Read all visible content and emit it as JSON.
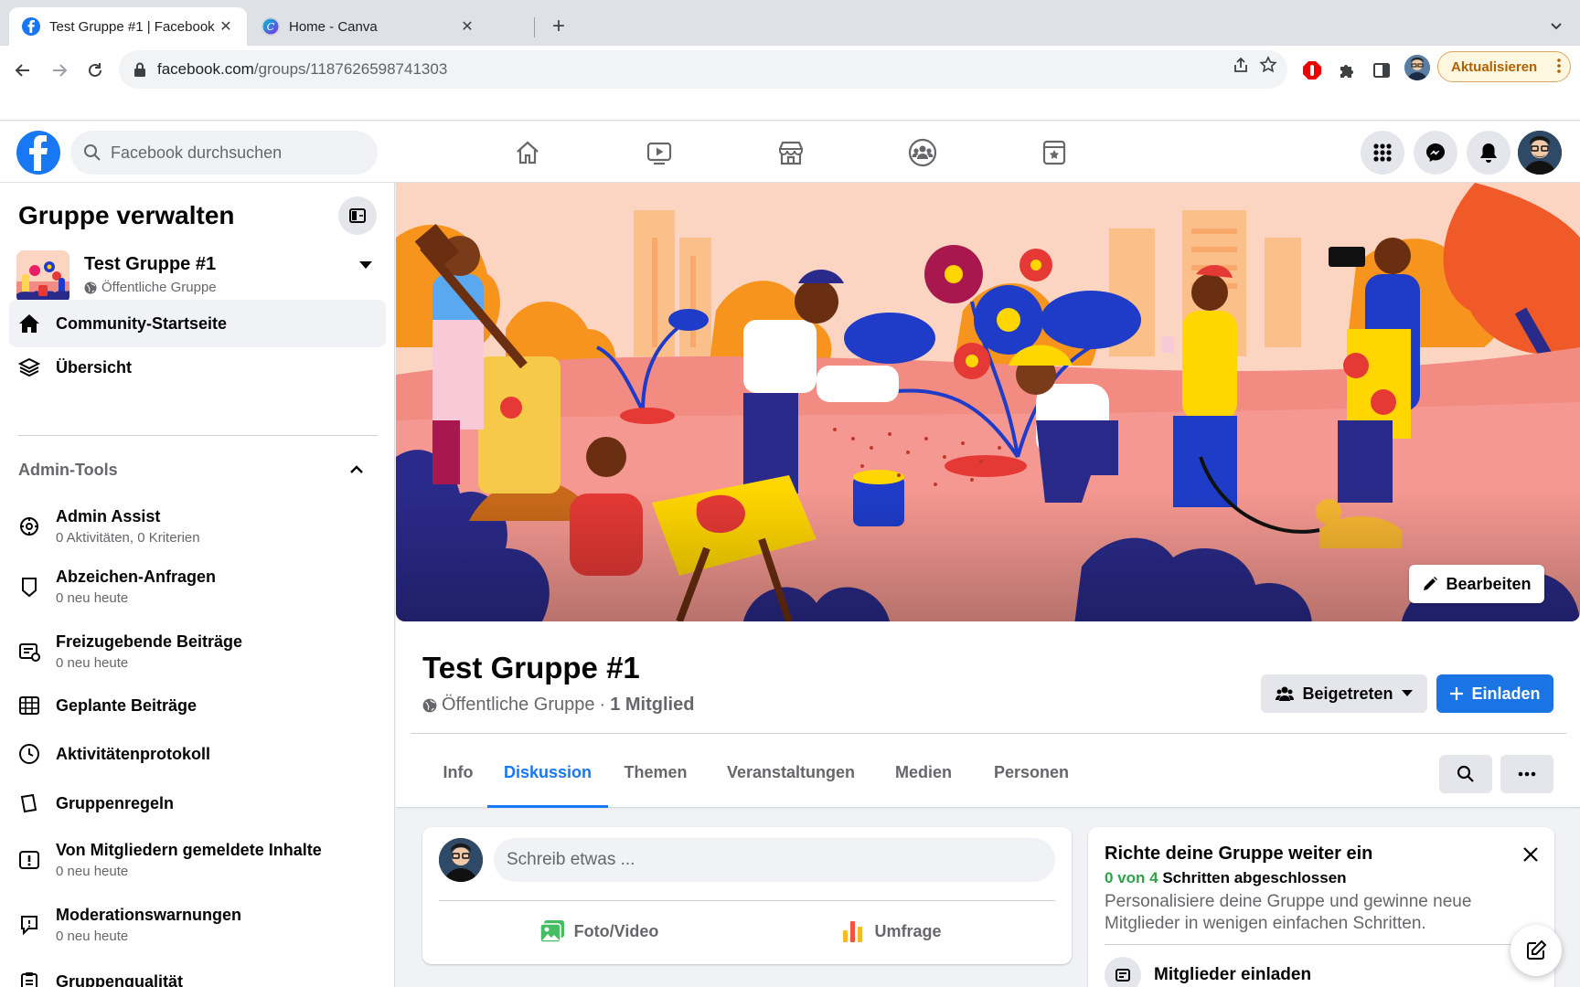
{
  "browser": {
    "tabs": [
      {
        "title": "Test Gruppe #1 | Facebook",
        "active": true
      },
      {
        "title": "Home - Canva",
        "active": false
      }
    ],
    "url_host": "facebook.com",
    "url_path": "/groups/1187626598741303",
    "update_label": "Aktualisieren",
    "colors": {
      "tabbar": "#dee1e6",
      "update_border": "#e0a461",
      "update_text": "#b06000"
    }
  },
  "header": {
    "search_placeholder": "Facebook durchsuchen",
    "nav_icons": [
      "home-icon",
      "watch-icon",
      "marketplace-icon",
      "groups-icon",
      "gaming-icon"
    ],
    "right_icons": [
      "menu-grid-icon",
      "messenger-icon",
      "notifications-icon"
    ],
    "brand_color": "#1877f2"
  },
  "sidebar": {
    "title": "Gruppe verwalten",
    "group_name": "Test Gruppe #1",
    "group_privacy": "Öffentliche Gruppe",
    "nav": [
      {
        "label": "Community-Startseite",
        "icon": "home-icon",
        "active": true
      },
      {
        "label": "Übersicht",
        "icon": "layers-icon",
        "active": false
      }
    ],
    "section_title": "Admin-Tools",
    "admin_tools": [
      {
        "label": "Admin Assist",
        "sub": "0 Aktivitäten, 0 Kriterien",
        "icon": "admin-assist-icon"
      },
      {
        "label": "Abzeichen-Anfragen",
        "sub": "0 neu heute",
        "icon": "badge-icon"
      },
      {
        "label": "Freizugebende Beiträge",
        "sub": "0 neu heute",
        "icon": "pending-posts-icon"
      },
      {
        "label": "Geplante Beiträge",
        "sub": "",
        "icon": "calendar-icon"
      },
      {
        "label": "Aktivitätenprotokoll",
        "sub": "",
        "icon": "clock-icon"
      },
      {
        "label": "Gruppenregeln",
        "sub": "",
        "icon": "rules-icon"
      },
      {
        "label": "Von Mitgliedern gemeldete Inhalte",
        "sub": "0 neu heute",
        "icon": "report-icon"
      },
      {
        "label": "Moderationswarnungen",
        "sub": "0 neu heute",
        "icon": "moderation-icon"
      },
      {
        "label": "Gruppenqualität",
        "sub": "",
        "icon": "quality-icon"
      }
    ]
  },
  "main": {
    "edit_cover_label": "Bearbeiten",
    "group_title": "Test Gruppe #1",
    "privacy": "Öffentliche Gruppe",
    "separator": "·",
    "members": "1 Mitglied",
    "joined_label": "Beigetreten",
    "invite_label": "Einladen",
    "tabs": [
      {
        "label": "Info",
        "active": false
      },
      {
        "label": "Diskussion",
        "active": true
      },
      {
        "label": "Themen",
        "active": false
      },
      {
        "label": "Veranstaltungen",
        "active": false
      },
      {
        "label": "Medien",
        "active": false
      },
      {
        "label": "Personen",
        "active": false
      }
    ],
    "composer": {
      "placeholder": "Schreib etwas ...",
      "photo_label": "Foto/Video",
      "poll_label": "Umfrage"
    },
    "setup_card": {
      "title": "Richte deine Gruppe weiter ein",
      "progress_count": "0 von 4",
      "progress_text": "Schritten abgeschlossen",
      "description": "Personalisiere deine Gruppe und gewinne neue Mitglieder in wenigen einfachen Schritten.",
      "step_label": "Mitglieder einladen"
    }
  }
}
